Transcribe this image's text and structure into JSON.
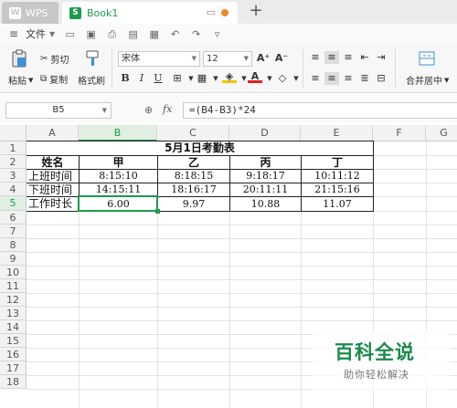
{
  "titlebar": {
    "app_tab": "WPS",
    "doc_tab": "Book1",
    "add_tab": "+"
  },
  "menu": {
    "file_label": "文件"
  },
  "ribbon": {
    "paste": "粘贴",
    "cut": "剪切",
    "copy": "复制",
    "format_painter": "格式刷",
    "font_name": "宋体",
    "font_size": "12",
    "merge_center": "合并居中"
  },
  "formula_bar": {
    "cell_ref": "B5",
    "fx": "fx",
    "formula": "=(B4-B3)*24"
  },
  "grid": {
    "columns": [
      "A",
      "B",
      "C",
      "D",
      "E",
      "F",
      "G"
    ],
    "rows": [
      "1",
      "2",
      "3",
      "4",
      "5",
      "6",
      "7",
      "8",
      "9",
      "10",
      "11",
      "12",
      "13",
      "14",
      "15",
      "16",
      "17",
      "18"
    ],
    "active_cell": "B5",
    "title": "5月1日考勤表",
    "header": [
      "姓名",
      "甲",
      "乙",
      "丙",
      "丁"
    ],
    "row3": [
      "上班时间",
      "8:15:10",
      "8:18:15",
      "9:18:17",
      "10:11:12"
    ],
    "row4": [
      "下班时间",
      "14:15:11",
      "18:16:17",
      "20:11:11",
      "21:15:16"
    ],
    "row5": [
      "工作时长",
      "6.00",
      "9.97",
      "10.88",
      "11.07"
    ]
  },
  "watermark": {
    "main": "百科全说",
    "sub": "助你轻松解决"
  },
  "colors": {
    "accent": "#1b9b4e",
    "tab_dot": "#f08a24",
    "font_color_red": "#e02020",
    "fill_yellow": "#f5c400"
  }
}
